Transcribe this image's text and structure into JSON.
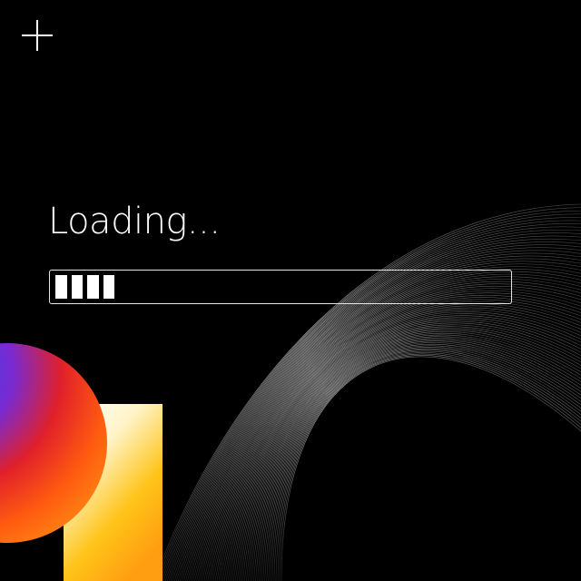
{
  "screen": {
    "loading_label": "Loading...",
    "progress": {
      "filled_segments": 4,
      "fraction": 0.13
    }
  },
  "icons": {
    "top_left": "plus-icon"
  },
  "colors": {
    "background": "#000000",
    "foreground": "#ffffff",
    "accent_blue": "#3a44f2",
    "accent_orange": "#ff6a10",
    "accent_yellow": "#ffc21a"
  }
}
